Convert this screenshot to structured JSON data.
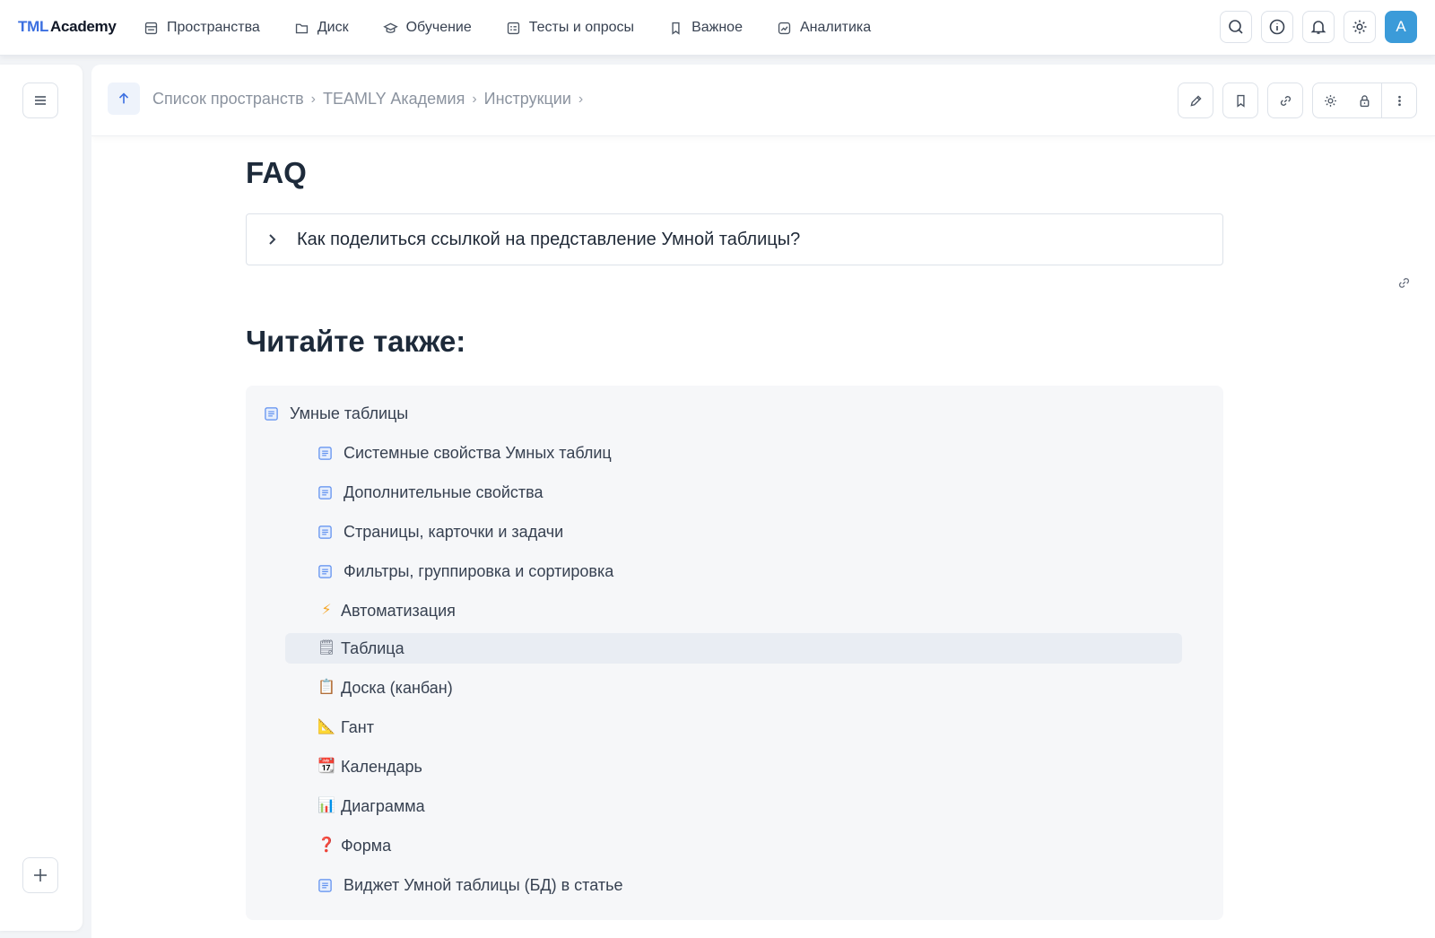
{
  "app": {
    "logo_brand": "TML",
    "logo_rest": "Academy"
  },
  "nav": [
    {
      "label": "Пространства",
      "icon": "spaces-icon"
    },
    {
      "label": "Диск",
      "icon": "folder-icon"
    },
    {
      "label": "Обучение",
      "icon": "graduation-cap-icon"
    },
    {
      "label": "Тесты и опросы",
      "icon": "checklist-icon"
    },
    {
      "label": "Важное",
      "icon": "bookmark-icon"
    },
    {
      "label": "Аналитика",
      "icon": "analytics-icon"
    }
  ],
  "user": {
    "avatar_letter": "A",
    "avatar_color": "#3b9bd9"
  },
  "breadcrumb": [
    "Список пространств",
    "TEAMLY Академия",
    "Инструкции"
  ],
  "breadcrumb_separator": "›",
  "page": {
    "title": "FAQ",
    "faq_question": "Как поделиться ссылкой на представление Умной таблицы?",
    "read_also": "Читайте также:"
  },
  "related": {
    "parent": {
      "label": "Умные таблицы",
      "icon": "doc-icon"
    },
    "children": [
      {
        "label": "Системные свойства Умных таблиц",
        "icon": "doc-icon"
      },
      {
        "label": "Дополнительные свойства",
        "icon": "doc-icon"
      },
      {
        "label": "Страницы, карточки и задачи",
        "icon": "doc-icon"
      },
      {
        "label": "Фильтры, группировка и сортировка",
        "icon": "doc-icon"
      },
      {
        "label": "Автоматизация",
        "icon": "lightning-icon",
        "glyph": "⚡"
      },
      {
        "label": "Таблица",
        "icon": "spreadsheet-icon",
        "glyph": "🗒",
        "selected": true
      },
      {
        "label": "Доска (канбан)",
        "icon": "clipboard-icon",
        "glyph": "📋"
      },
      {
        "label": "Гант",
        "icon": "ruler-icon",
        "glyph": "📐"
      },
      {
        "label": "Календарь",
        "icon": "calendar-icon",
        "glyph": "📆"
      },
      {
        "label": "Диаграмма",
        "icon": "bar-chart-icon",
        "glyph": "📊"
      },
      {
        "label": "Форма",
        "icon": "question-icon",
        "glyph": "❓"
      },
      {
        "label": "Виджет Умной таблицы (БД) в статье",
        "icon": "doc-icon"
      }
    ]
  },
  "colors": {
    "accent": "#3b6fe0",
    "doc_icon": "#5b8def",
    "selected_row": "#e9edf3"
  }
}
